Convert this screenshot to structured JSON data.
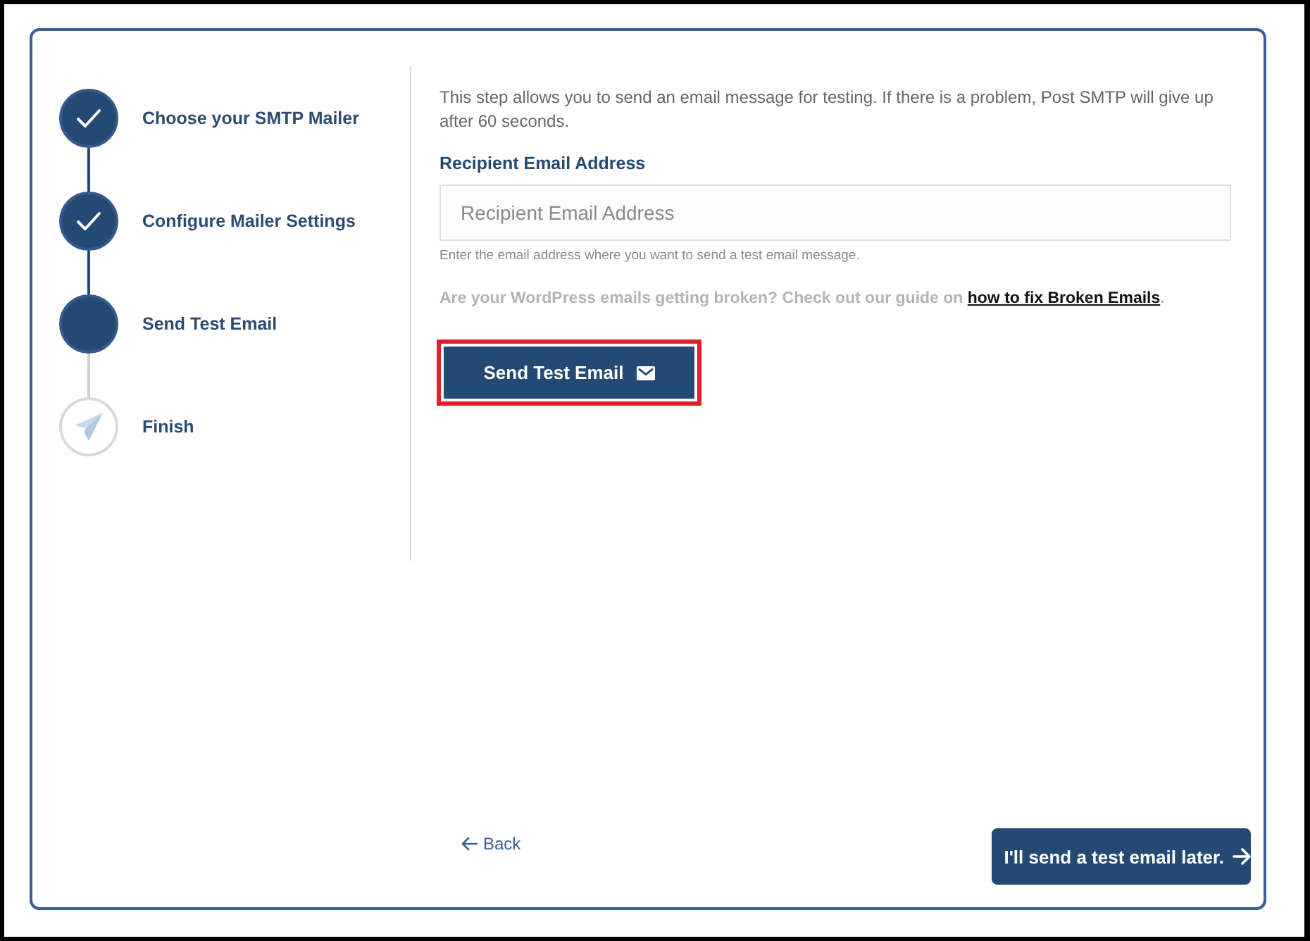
{
  "steps": [
    {
      "label": "Choose your SMTP Mailer",
      "kind": "done"
    },
    {
      "label": "Configure Mailer Settings",
      "kind": "done"
    },
    {
      "label": "Send Test Email",
      "kind": "current"
    },
    {
      "label": "Finish",
      "kind": "pending"
    }
  ],
  "content": {
    "description": "This step allows you to send an email message for testing. If there is a problem, Post SMTP will give up after 60 seconds.",
    "field": {
      "label": "Recipient Email Address",
      "placeholder": "Recipient Email Address",
      "help": "Enter the email address where you want to send a test email message."
    },
    "guide": {
      "text": "Are your WordPress emails getting broken? Check out our guide on ",
      "link": "how to fix Broken Emails",
      "after_link": "."
    },
    "send_button": {
      "label": "Send Test Email",
      "highlighted": true
    }
  },
  "footer": {
    "back": "Back",
    "next": "I'll send a test email later."
  }
}
